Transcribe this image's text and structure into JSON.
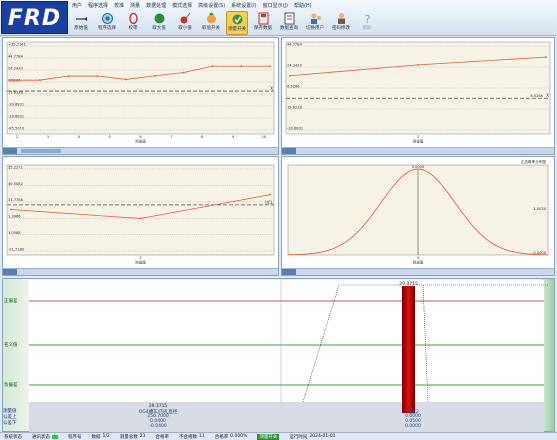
{
  "app": {
    "logo_text": "FRD"
  },
  "menu": [
    "用户",
    "程序选择",
    "校准",
    "测量",
    "数据处理",
    "模式选择",
    "高级设置(S)",
    "系统设置(I)",
    "窗口显示(J)",
    "帮助(H)"
  ],
  "toolbar": [
    {
      "label": "原始值",
      "icon": "ruler-icon",
      "active": false,
      "disabled": false
    },
    {
      "label": "程序选择",
      "icon": "program-select-icon",
      "active": false,
      "disabled": false
    },
    {
      "label": "校零",
      "icon": "zero-calibration-icon",
      "active": false,
      "disabled": false
    },
    {
      "label": "取大值",
      "icon": "max-value-icon",
      "active": false,
      "disabled": false
    },
    {
      "label": "取小值",
      "icon": "min-value-icon",
      "active": false,
      "disabled": false
    },
    {
      "label": "取值开关",
      "icon": "value-switch-icon",
      "active": false,
      "disabled": false
    },
    {
      "label": "测量开关",
      "icon": "measure-switch-icon",
      "active": true,
      "disabled": false
    },
    {
      "label": "保存数据",
      "icon": "save-data-icon",
      "active": false,
      "disabled": false
    },
    {
      "label": "数据查询",
      "icon": "data-query-icon",
      "active": false,
      "disabled": false
    },
    {
      "label": "切换用户",
      "icon": "switch-user-icon",
      "active": false,
      "disabled": false
    },
    {
      "label": "密码修改",
      "icon": "password-change-icon",
      "active": false,
      "disabled": false
    },
    {
      "label": "帮助",
      "icon": "help-icon",
      "active": false,
      "disabled": true
    }
  ],
  "colors": {
    "series": "#e05a3a",
    "center_line": "#555555",
    "limit_line": "#0a7a0a",
    "bar": "#c00000",
    "logo_bg": "#1a3fa3"
  },
  "panels": {
    "tl": {
      "chart_data": {
        "type": "line",
        "x": [
          1,
          2,
          3,
          4,
          5,
          6,
          7,
          8,
          9,
          10
        ],
        "y": [
          15.1,
          15.1,
          17.8,
          17.8,
          15.6,
          17.9,
          20.1,
          24.2,
          24.2,
          24.2
        ],
        "ylim": [
          -20,
          40
        ],
        "y_ticks": [
          "+35.7141",
          "44.7784",
          "24.2420",
          "6.5266",
          "15.6238",
          "-30.6831",
          "-30.6831",
          "-85.5010"
        ],
        "x_ticks": [
          "2",
          "3",
          "4",
          "5",
          "6",
          "7",
          "8",
          "9",
          "10"
        ],
        "xlabel": "测量值",
        "center_label": "X"
      }
    },
    "tr": {
      "chart_data": {
        "type": "line",
        "x": [
          0,
          1,
          2
        ],
        "y": [
          13.5,
          18.8,
          22.6
        ],
        "ylim": [
          -15,
          30
        ],
        "y_ticks": [
          "44.7784",
          "24.2420",
          "6.5266",
          "15.6238",
          "-30.6831"
        ],
        "x_ticks": [
          "2"
        ],
        "xlabel": "测量值",
        "center_value": "6.5266",
        "center_label": "X"
      }
    },
    "bl": {
      "chart_data": {
        "type": "line",
        "x": [
          0,
          1,
          2
        ],
        "y": [
          11.8,
          6.5,
          20.5
        ],
        "ylim": [
          -15,
          38
        ],
        "y_ticks": [
          "35.2271",
          "40.5082",
          "11.7788",
          "1.3966",
          "1.0568",
          "-21.7180"
        ],
        "x_ticks": [
          "2"
        ],
        "xlabel": "测量值",
        "center_label": "UCL"
      }
    },
    "br": {
      "chart_data": {
        "type": "line",
        "title": "正态概率分布图",
        "y_left_top": "0.0000",
        "y_right": "1.0030",
        "y_bottom_right": "0.0000",
        "x_label": "测量值",
        "x_center": "0"
      }
    }
  },
  "control": {
    "labels": [
      "正偏差",
      "名义值",
      "负偏差"
    ],
    "peak_value": "29.3715",
    "left_value": "29.3715",
    "left_name": "OG4槽车/内孔直径",
    "left_stats": [
      "250.7000",
      "0.0400",
      "-0.0400"
    ],
    "right_name": "圆度2",
    "right_stats": [
      "0.0000",
      "0.0500",
      "0.0000"
    ],
    "side_rows": [
      "测量值",
      "公差上",
      "公差下"
    ]
  },
  "status": [
    {
      "label": "系统状态",
      "value": ""
    },
    {
      "label": "通讯状态",
      "value": "",
      "led": true
    },
    {
      "label": "程序号",
      "value": ""
    },
    {
      "label": "数据",
      "value": "1/2"
    },
    {
      "label": "测量总数",
      "value": "23"
    },
    {
      "label": "合格率",
      "value": ""
    },
    {
      "label": "不合格数",
      "value": "11"
    },
    {
      "label": "合格率",
      "value": "0.000%"
    },
    {
      "label": "",
      "value": "测量开关",
      "badge": true
    },
    {
      "label": "运行时间",
      "value": "2024-01-01"
    }
  ]
}
